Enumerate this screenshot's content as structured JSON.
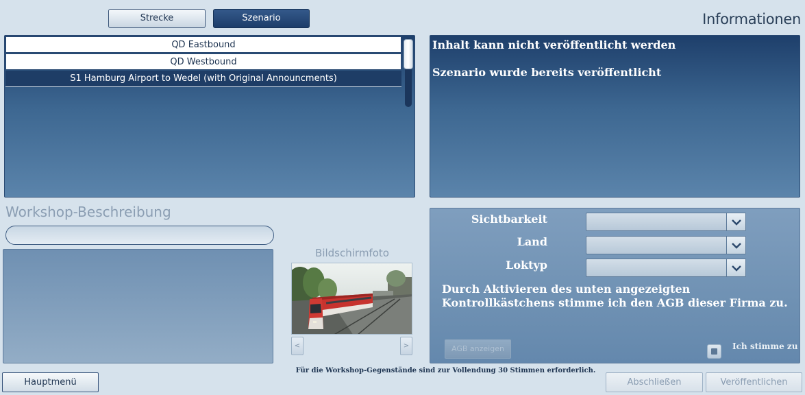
{
  "tabs": [
    {
      "label": "Strecke",
      "active": false
    },
    {
      "label": "Szenario",
      "active": true
    }
  ],
  "info_heading": "Informationen",
  "scenario_list": {
    "items": [
      {
        "label": "QD Eastbound",
        "selected": false
      },
      {
        "label": "QD Westbound",
        "selected": false
      },
      {
        "label": "S1 Hamburg Airport to Wedel (with Original Announcments)",
        "selected": true
      }
    ]
  },
  "info_panel": {
    "line1": "Inhalt kann nicht veröffentlicht werden",
    "line2": "Szenario wurde bereits veröffentlicht"
  },
  "workshop": {
    "label": "Workshop-Beschreibung",
    "title_value": "",
    "description_value": ""
  },
  "screenshot": {
    "label": "Bildschirmfoto",
    "prev_glyph": "<",
    "next_glyph": ">"
  },
  "settings": {
    "visibility_label": "Sichtbarkeit",
    "visibility_value": "",
    "country_label": "Land",
    "country_value": "",
    "loco_label": "Loktyp",
    "loco_value": "",
    "agb_text": "Durch Aktivieren des unten angezeigten Kontrollkästchens stimme ich den AGB dieser Firma zu.",
    "agb_button": "AGB anzeigen",
    "agree_label": "Ich stimme zu",
    "agree_checked": false
  },
  "footer": {
    "main_menu": "Hauptmenü",
    "vote_note": "Für die Workshop-Gegenstände sind zur Vollendung 30 Stimmen erforderlich.",
    "finish": "Abschließen",
    "publish": "Veröffentlichen"
  },
  "colors": {
    "accent": "#1e3d66",
    "background": "#d6e2ec",
    "panel_text": "#ffffff"
  }
}
